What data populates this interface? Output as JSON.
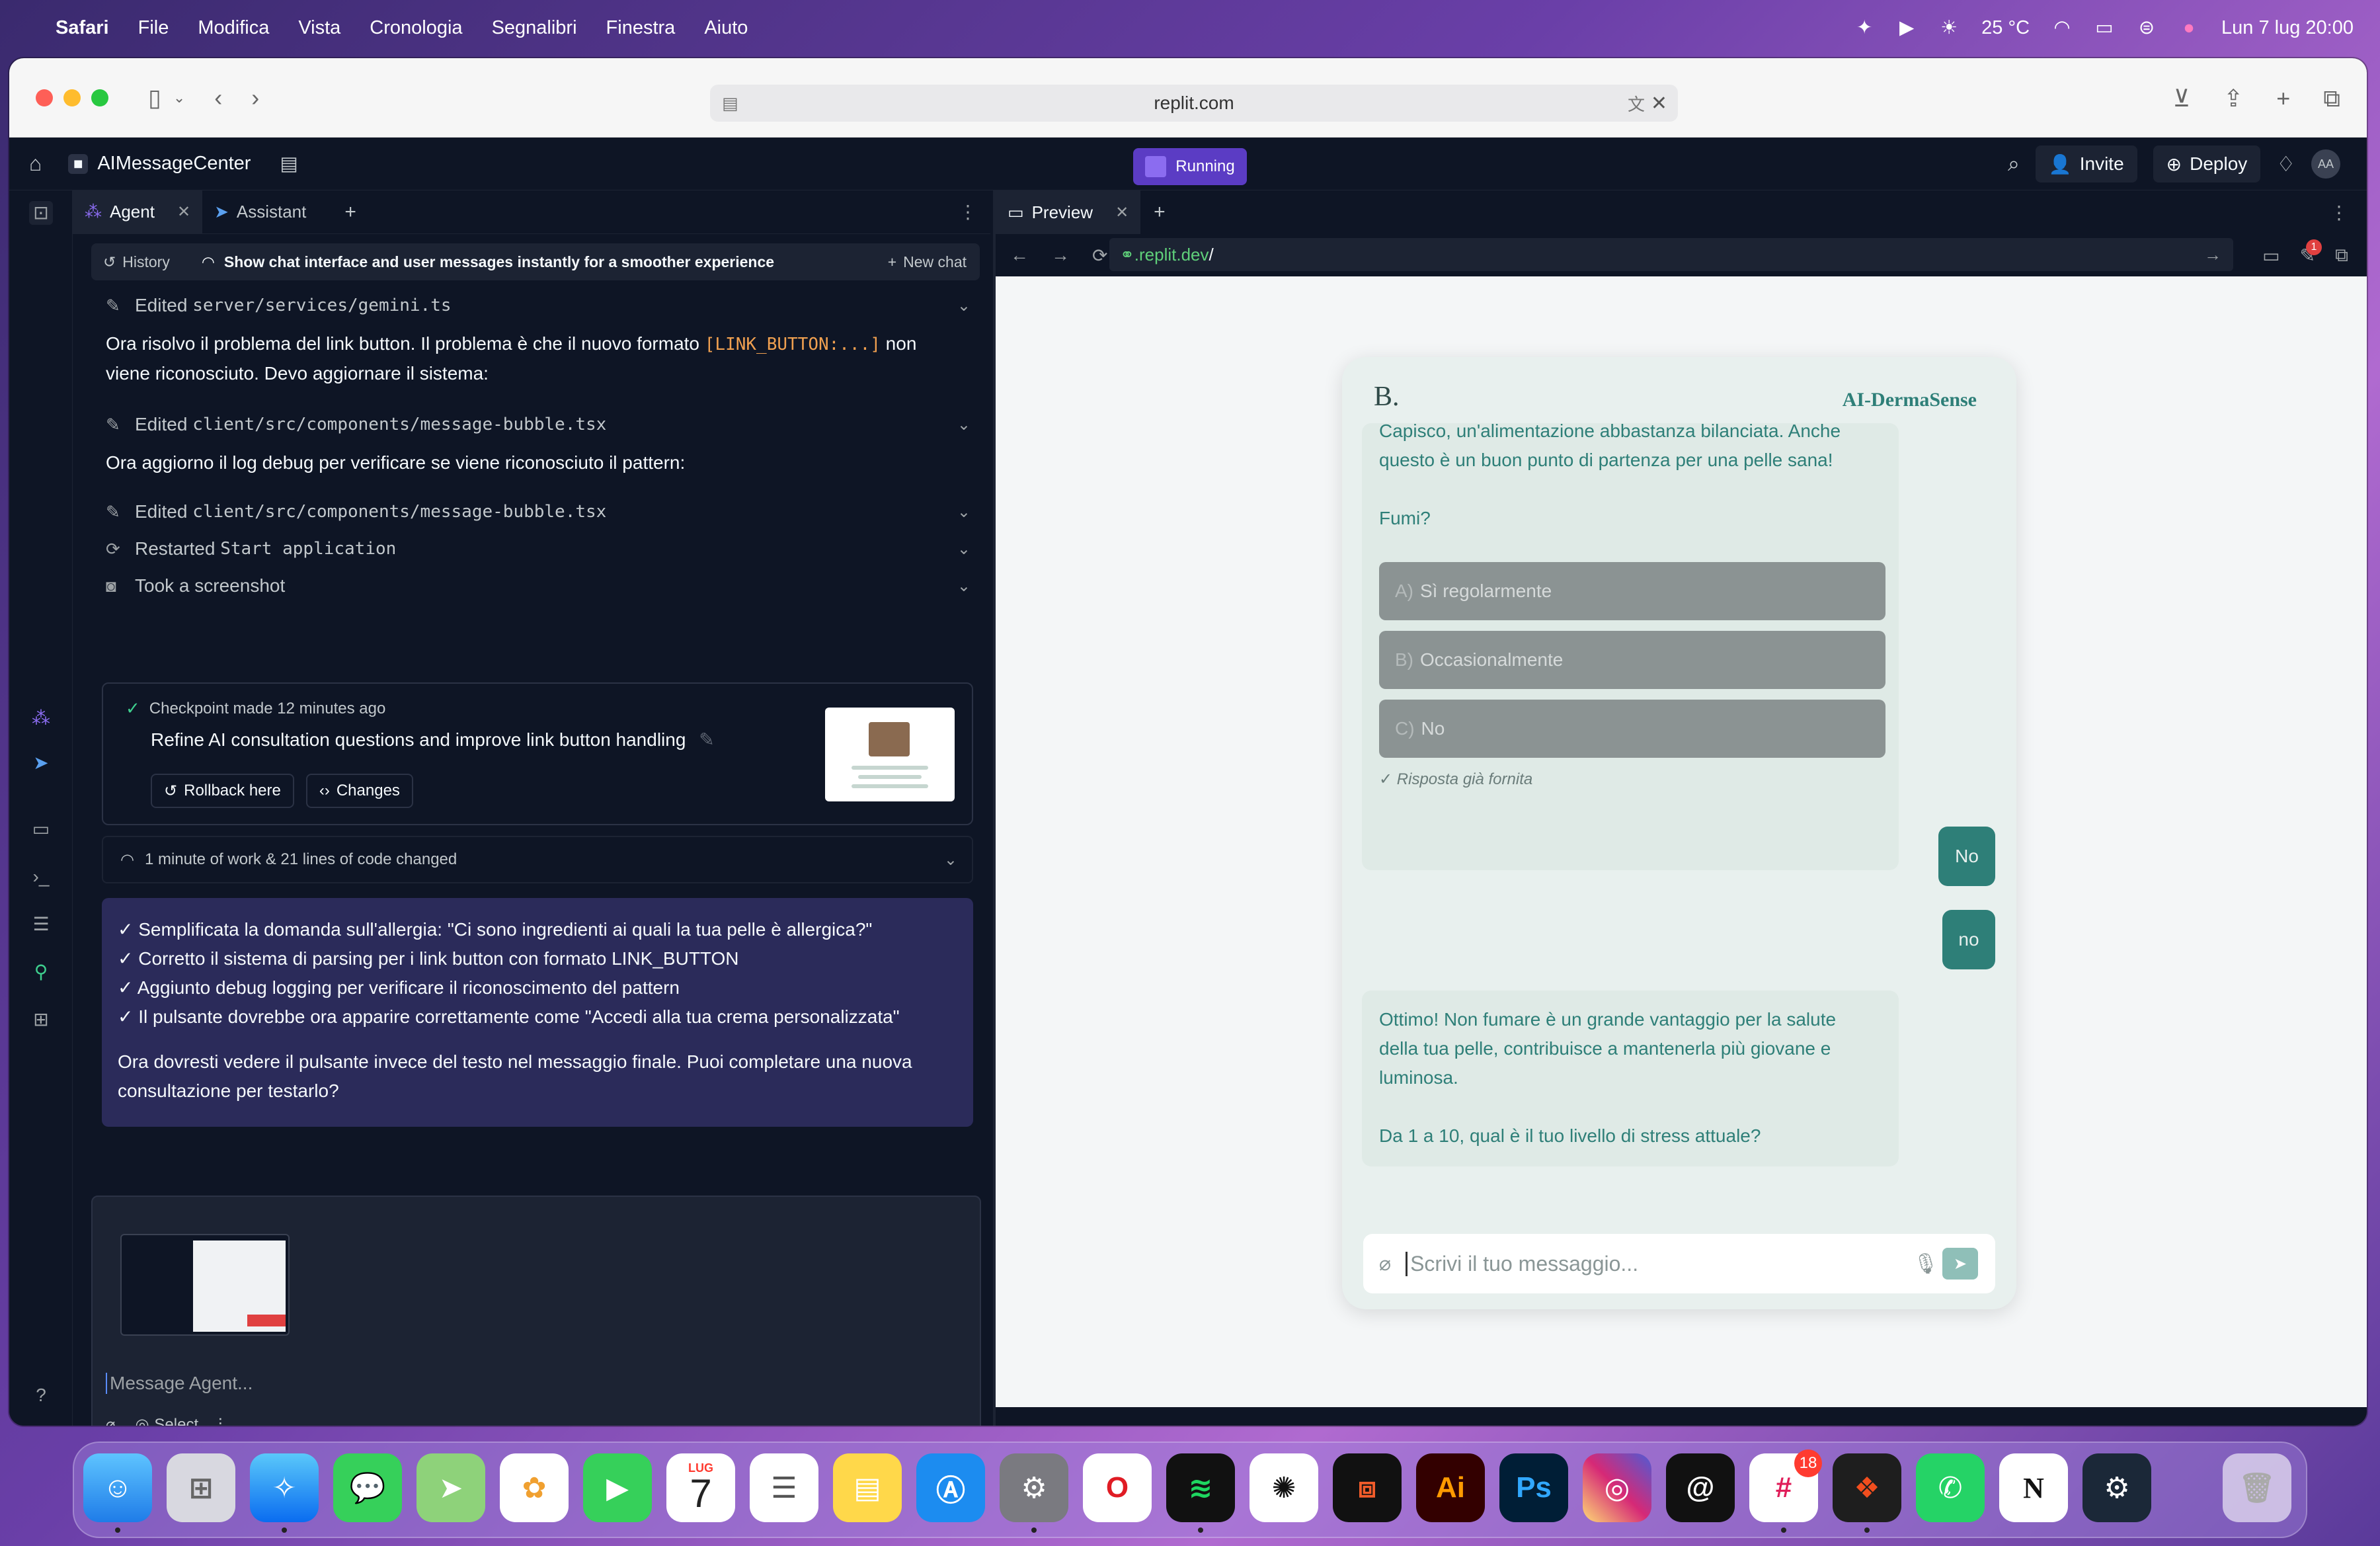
{
  "menubar": {
    "app": "Safari",
    "items": [
      "File",
      "Modifica",
      "Vista",
      "Cronologia",
      "Segnalibri",
      "Finestra",
      "Aiuto"
    ],
    "weather": "25 °C",
    "datetime": "Lun 7 lug  20:00"
  },
  "safari": {
    "url": "replit.com"
  },
  "replit": {
    "project_name": "AIMessageCenter",
    "status": "Running",
    "invite_label": "Invite",
    "deploy_label": "Deploy",
    "avatar": "AA"
  },
  "left": {
    "tabs": [
      {
        "label": "Agent"
      },
      {
        "label": "Assistant"
      }
    ],
    "history_label": "History",
    "thread_title": "Show chat interface and user messages instantly for a smoother experience",
    "new_chat_label": "New chat",
    "log": {
      "edit1_prefix": "Edited",
      "edit1_file": "server/services/gemini.ts",
      "msg1_a": "Ora risolvo il problema del link button. Il problema è che il nuovo formato",
      "msg1_code": "[LINK_BUTTON:...]",
      "msg1_b": "non",
      "msg1_c": "viene riconosciuto. Devo aggiornare il sistema:",
      "edit2_prefix": "Edited",
      "edit2_file": "client/src/components/message-bubble.tsx",
      "msg2": "Ora aggiorno il log debug per verificare se viene riconosciuto il pattern:",
      "edit3_prefix": "Edited",
      "edit3_file": "client/src/components/message-bubble.tsx",
      "restart_prefix": "Restarted",
      "restart_name": "Start application",
      "screenshot": "Took a screenshot"
    },
    "checkpoint": {
      "header": "Checkpoint made 12 minutes ago",
      "title": "Refine AI consultation questions and improve link button handling",
      "rollback_label": "Rollback here",
      "changes_label": "Changes"
    },
    "work_summary": "1 minute of work & 21 lines of code changed",
    "summary": {
      "lines": [
        "✓ Semplificata la domanda sull'allergia: \"Ci sono ingredienti ai quali la tua pelle è allergica?\"",
        "✓ Corretto il sistema di parsing per i link button con formato LINK_BUTTON",
        "✓ Aggiunto debug logging per verificare il riconoscimento del pattern",
        "✓ Il pulsante dovrebbe ora apparire correttamente come \"Accedi alla tua crema personalizzata\""
      ],
      "closing_1": "Ora dovresti vedere il pulsante invece del testo nel messaggio finale. Puoi completare una nuova",
      "closing_2": "consultazione per testarlo?"
    },
    "composer": {
      "placeholder": "Message Agent...",
      "select_label": "Select"
    }
  },
  "right": {
    "tab_label": "Preview",
    "url_prefix": ".replit.dev",
    "url_suffix": "/",
    "notif_count": "1"
  },
  "app": {
    "brand": "B.",
    "title": "AI-DermaSense",
    "bot1_line1": "Capisco, un'alimentazione abbastanza bilanciata. Anche",
    "bot1_line2": "questo è un buon punto di partenza per una pelle sana!",
    "bot1_question": "Fumi?",
    "options": [
      {
        "letter": "A)",
        "text": "Sì regolarmente"
      },
      {
        "letter": "B)",
        "text": "Occasionalmente"
      },
      {
        "letter": "C)",
        "text": "No"
      }
    ],
    "answered": "✓ Risposta già fornita",
    "user_msgs": [
      "No",
      "no"
    ],
    "bot2_line1": "Ottimo! Non fumare è un grande vantaggio per la salute",
    "bot2_line2": "della tua pelle, contribuisce a mantenerla più giovane e",
    "bot2_line3": "luminosa.",
    "bot2_question": "Da 1 a 10, qual è il tuo livello di stress attuale?",
    "input_placeholder": "Scrivi il tuo messaggio..."
  },
  "dock": {
    "calendar_month": "LUG",
    "calendar_day": "7",
    "slack_badge": "18",
    "illustrator_label": "Ai",
    "photoshop_label": "Ps",
    "notion_label": "N"
  }
}
